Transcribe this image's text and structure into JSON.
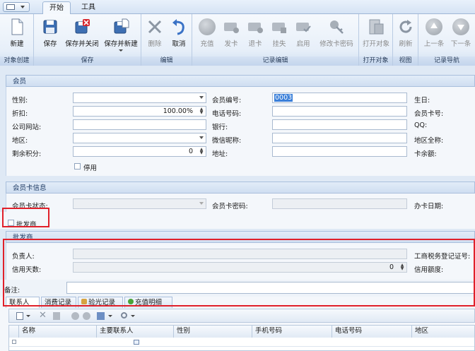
{
  "ribbon": {
    "tabs": [
      "开始",
      "工具"
    ],
    "groups": {
      "object_create": "对象创建",
      "save": "保存",
      "edit": "编辑",
      "record_edit": "记录编辑",
      "open_object": "打开对象",
      "view": "视图",
      "record_nav": "记录导航"
    },
    "buttons": {
      "new": "新建",
      "save": "保存",
      "save_close": "保存并关闭",
      "save_new": "保存并新建",
      "delete": "删除",
      "cancel": "取消",
      "recharge": "充值",
      "issue_card": "发卡",
      "return_card": "退卡",
      "report_loss": "挂失",
      "enable": "启用",
      "change_pwd": "修改卡密码",
      "open_object": "打开对象",
      "refresh": "刷新",
      "prev": "上一条",
      "next": "下一条"
    }
  },
  "member": {
    "title": "会员",
    "gender_label": "性别:",
    "member_no_label": "会员编号:",
    "member_no_value": "0003",
    "birthday_label": "生日:",
    "discount_label": "折扣:",
    "discount_value": "100.00%",
    "phone_label": "电话号码:",
    "card_no_label": "会员卡号:",
    "website_label": "公司网站:",
    "bank_label": "银行:",
    "qq_label": "QQ:",
    "region_label": "地区:",
    "wechat_label": "微信昵称:",
    "region_full_label": "地区全称:",
    "points_label": "剩余积分:",
    "points_value": "0",
    "address_label": "地址:",
    "balance_label": "卡余额:",
    "disabled_label": "停用"
  },
  "card": {
    "title": "会员卡信息",
    "status_label": "会员卡状态:",
    "pwd_label": "会员卡密码:",
    "date_label": "办卡日期:"
  },
  "wholesale_checkbox_label": "批发商",
  "wholesaler": {
    "title": "批发商",
    "owner_label": "负责人:",
    "tax_label": "工商税务登记证号:",
    "credit_days_label": "信用天数:",
    "credit_days_value": "0",
    "credit_limit_label": "信用额度:"
  },
  "remarks_label": "备注:",
  "subtabs": [
    "联系人",
    "消费记录",
    "验光记录",
    "充值明细"
  ],
  "grid": {
    "columns": [
      "名称",
      "主要联系人",
      "性别",
      "手机号码",
      "电话号码",
      "地区"
    ]
  }
}
